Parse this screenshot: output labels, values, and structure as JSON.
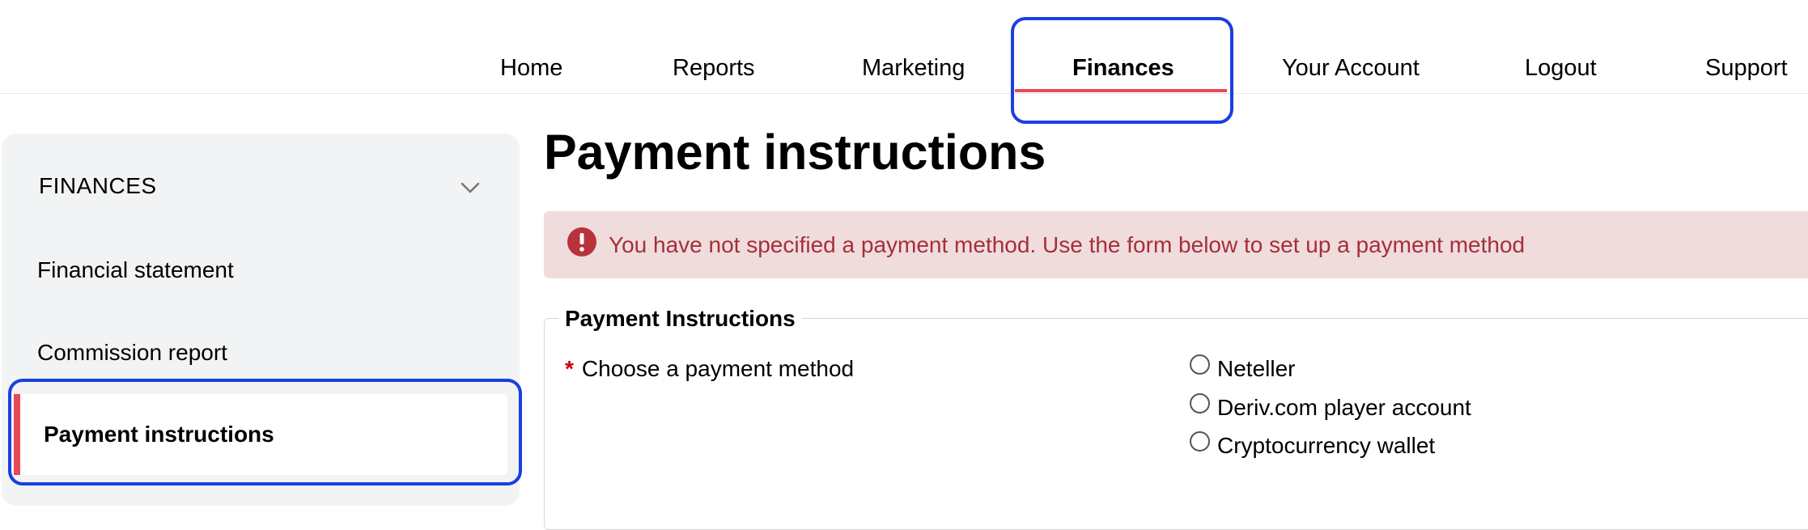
{
  "nav": {
    "items": [
      {
        "label": "Home"
      },
      {
        "label": "Reports"
      },
      {
        "label": "Marketing"
      },
      {
        "label": "Finances",
        "active": true
      },
      {
        "label": "Your Account"
      },
      {
        "label": "Logout"
      },
      {
        "label": "Support"
      }
    ]
  },
  "sidebar": {
    "header": "FINANCES",
    "items": [
      {
        "label": "Financial statement"
      },
      {
        "label": "Commission report"
      },
      {
        "label": "Payment instructions",
        "active": true
      }
    ]
  },
  "main": {
    "title": "Payment instructions",
    "alert": {
      "message": "You have not specified a payment method. Use the form below to set up a payment method"
    },
    "form": {
      "legend": "Payment Instructions",
      "required_mark": "*",
      "field_label": "Choose a payment method",
      "options": [
        {
          "label": "Neteller"
        },
        {
          "label": "Deriv.com player account"
        },
        {
          "label": "Cryptocurrency wallet"
        }
      ]
    }
  },
  "colors": {
    "accent": "#e84a55",
    "highlight": "#1a3fe0",
    "alert_bg": "#f1dcdd",
    "alert_text": "#a3303a",
    "sidebar_bg": "#f2f3f4"
  }
}
